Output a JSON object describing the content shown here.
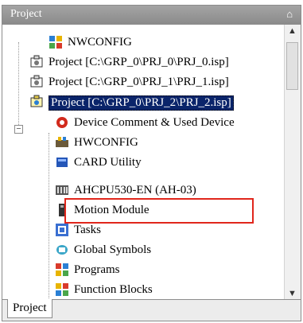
{
  "panel": {
    "title": "Project",
    "pin_glyph": "⌂"
  },
  "tree": {
    "items": [
      {
        "label": "NWCONFIG",
        "icon": "network-config-icon"
      },
      {
        "label": "Project [C:\\GRP_0\\PRJ_0\\PRJ_0.isp]",
        "icon": "project-icon"
      },
      {
        "label": "Project [C:\\GRP_0\\PRJ_1\\PRJ_1.isp]",
        "icon": "project-icon"
      },
      {
        "label": "Project [C:\\GRP_0\\PRJ_2\\PRJ_2.isp]",
        "icon": "project-icon",
        "selected": true,
        "expanded": true
      },
      {
        "label": "Device Comment & Used Device",
        "icon": "device-comment-icon"
      },
      {
        "label": "HWCONFIG",
        "icon": "hardware-config-icon"
      },
      {
        "label": "CARD Utility",
        "icon": "card-utility-icon"
      },
      {
        "label": "AHCPU530-EN  (AH-03)",
        "icon": "cpu-module-icon",
        "highlighted": true
      },
      {
        "label": "Motion Module",
        "icon": "motion-module-icon"
      },
      {
        "label": "Tasks",
        "icon": "tasks-icon"
      },
      {
        "label": "Global Symbols",
        "icon": "global-symbols-icon"
      },
      {
        "label": "Programs",
        "icon": "programs-icon"
      },
      {
        "label": "Function Blocks",
        "icon": "function-blocks-icon"
      }
    ],
    "expander_glyph": "−"
  },
  "tabs": [
    {
      "label": "Project",
      "active": true
    }
  ],
  "colors": {
    "selection": "#0a246a",
    "highlight_box": "#e0261c",
    "titlebar": "#9a9a9a"
  }
}
